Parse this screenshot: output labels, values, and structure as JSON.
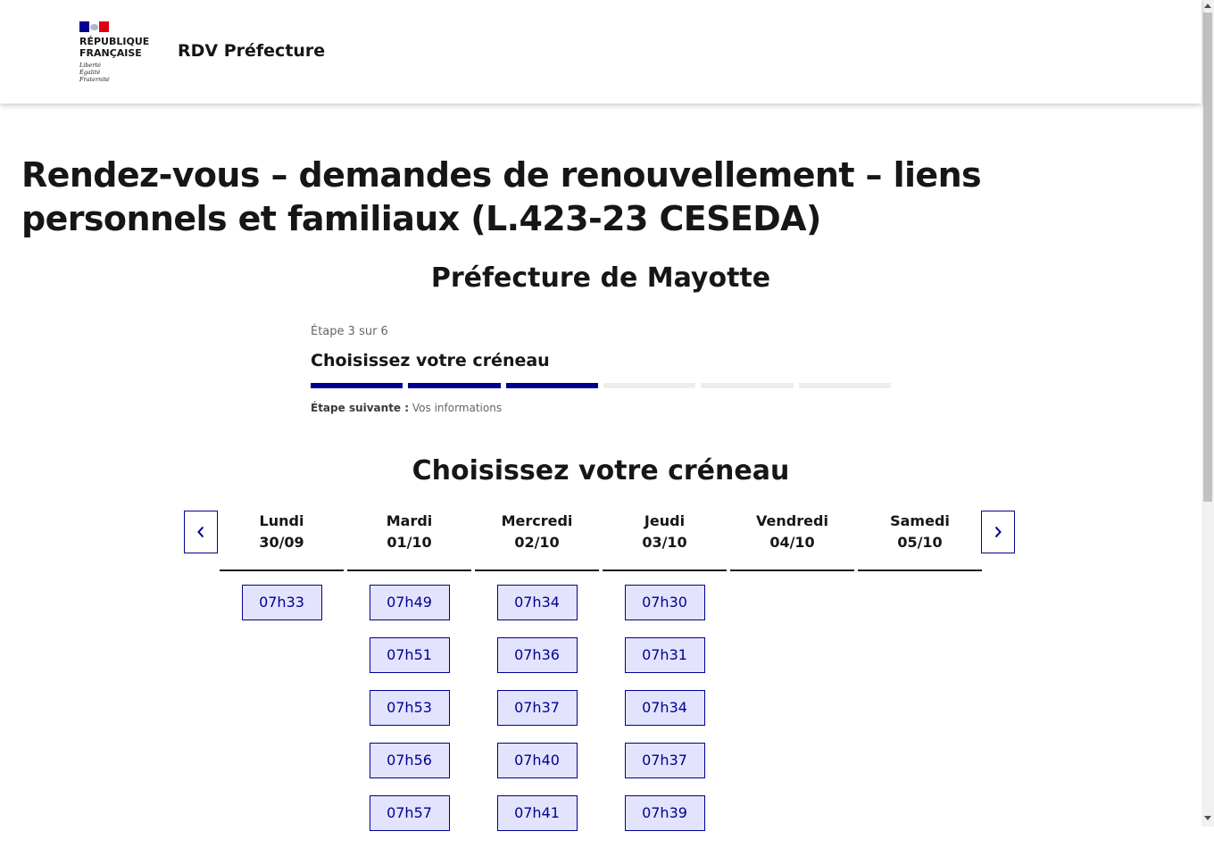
{
  "header": {
    "logo_line1": "RÉPUBLIQUE",
    "logo_line2": "FRANÇAISE",
    "motto_1": "Liberté",
    "motto_2": "Égalité",
    "motto_3": "Fraternité",
    "service_title": "RDV Préfecture"
  },
  "main": {
    "page_title": "Rendez-vous – demandes de renouvellement – liens personnels et familiaux (L.423-23 CESEDA)",
    "prefecture": "Préfecture de Mayotte"
  },
  "stepper": {
    "state": "Étape 3 sur 6",
    "current": 3,
    "total": 6,
    "title": "Choisissez votre créneau",
    "next_label": "Étape suivante :",
    "next_value": "Vos informations"
  },
  "slots_section": {
    "title": "Choisissez votre créneau",
    "days": [
      {
        "name": "Lundi",
        "date": "30/09",
        "slots": [
          "07h33"
        ]
      },
      {
        "name": "Mardi",
        "date": "01/10",
        "slots": [
          "07h49",
          "07h51",
          "07h53",
          "07h56",
          "07h57"
        ]
      },
      {
        "name": "Mercredi",
        "date": "02/10",
        "slots": [
          "07h34",
          "07h36",
          "07h37",
          "07h40",
          "07h41"
        ]
      },
      {
        "name": "Jeudi",
        "date": "03/10",
        "slots": [
          "07h30",
          "07h31",
          "07h34",
          "07h37",
          "07h39"
        ]
      },
      {
        "name": "Vendredi",
        "date": "04/10",
        "slots": []
      },
      {
        "name": "Samedi",
        "date": "05/10",
        "slots": []
      }
    ]
  },
  "icons": {
    "prev": "chevron-left-icon",
    "next": "chevron-right-icon"
  },
  "colors": {
    "primary": "#000091",
    "slot_bg": "#e3e3fd",
    "step_inactive": "#eeeeee",
    "flag_red": "#e1000f"
  }
}
